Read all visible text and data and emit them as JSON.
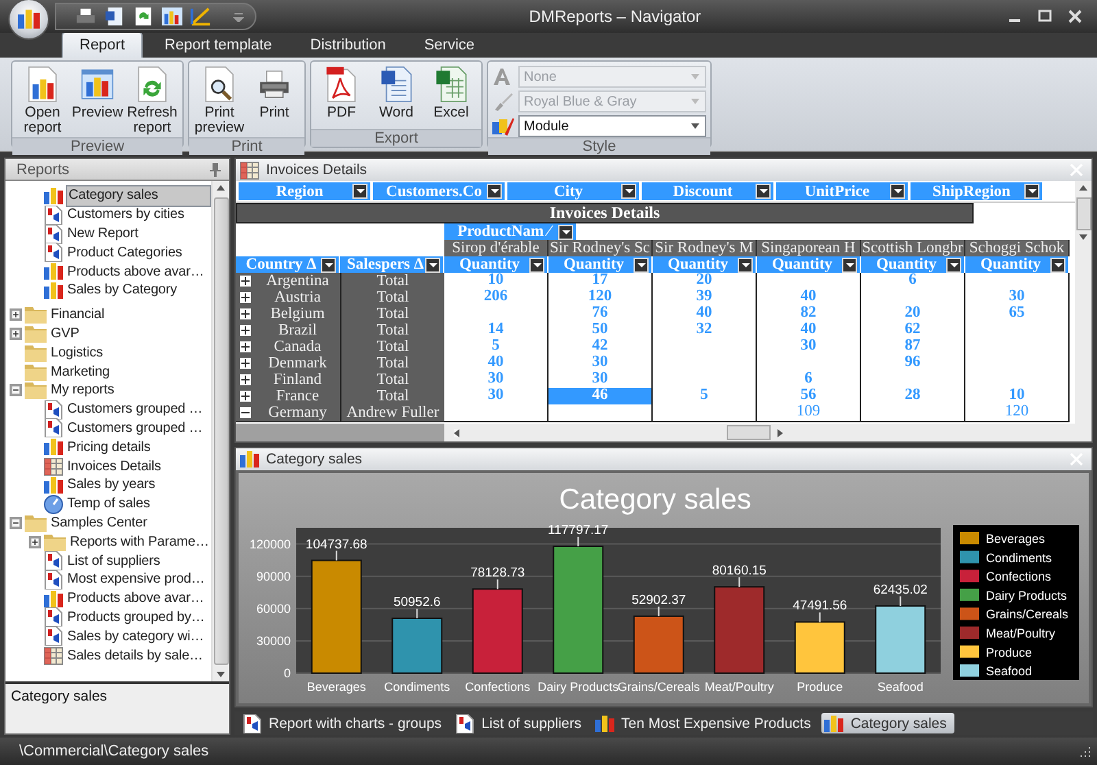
{
  "window": {
    "title": "DMReports – Navigator"
  },
  "ribbon_tabs": [
    {
      "label": "Report",
      "selected": true
    },
    {
      "label": "Report template",
      "selected": false
    },
    {
      "label": "Distribution",
      "selected": false
    },
    {
      "label": "Service",
      "selected": false
    }
  ],
  "ribbon_groups": [
    {
      "title": "Preview",
      "kind": "buttons",
      "buttons": [
        {
          "label": "Open report",
          "kind": "open"
        },
        {
          "label": "Preview",
          "kind": "preview"
        },
        {
          "label": "Refresh report",
          "kind": "refresh"
        }
      ]
    },
    {
      "title": "Print",
      "kind": "buttons",
      "buttons": [
        {
          "label": "Print preview",
          "kind": "print-preview"
        },
        {
          "label": "Print",
          "kind": "print"
        }
      ]
    },
    {
      "title": "Export",
      "kind": "buttons",
      "buttons": [
        {
          "label": "PDF",
          "kind": "pdf"
        },
        {
          "label": "Word",
          "kind": "word"
        },
        {
          "label": "Excel",
          "kind": "excel"
        }
      ]
    },
    {
      "title": "Style",
      "kind": "selects",
      "selects": [
        {
          "value": "None",
          "kind": "font",
          "disabled": true
        },
        {
          "value": "Royal Blue & Gray",
          "kind": "brush",
          "disabled": true
        },
        {
          "value": "Module",
          "kind": "palette",
          "disabled": false
        }
      ]
    }
  ],
  "left_panel": {
    "title": "Reports",
    "tree": {
      "continued": [
        {
          "label": "Category sales",
          "kind": "chart",
          "selected": true
        },
        {
          "label": "Customers by cities",
          "kind": "doc",
          "selected": false
        },
        {
          "label": "New Report",
          "kind": "doc",
          "selected": false
        },
        {
          "label": "Product Categories",
          "kind": "doc",
          "selected": false
        },
        {
          "label": "Products above avar…",
          "kind": "chart",
          "selected": false
        },
        {
          "label": "Sales by Category",
          "kind": "chart",
          "selected": false
        }
      ],
      "folders": [
        {
          "label": "Financial",
          "kind": "folder",
          "expanded": false,
          "selected": false
        },
        {
          "label": "GVP",
          "kind": "folder",
          "expanded": false,
          "selected": false
        },
        {
          "label": "Logistics",
          "kind": "folder",
          "selected": false
        },
        {
          "label": "Marketing",
          "kind": "folder",
          "selected": false
        },
        {
          "label": "My reports",
          "kind": "folder",
          "expanded": true,
          "selected": false,
          "children": [
            {
              "label": "Customers grouped …",
              "kind": "doc",
              "selected": false
            },
            {
              "label": "Customers grouped …",
              "kind": "doc",
              "selected": false
            },
            {
              "label": "Pricing details",
              "kind": "chart",
              "selected": false
            },
            {
              "label": "Invoices Details",
              "kind": "table",
              "selected": false
            },
            {
              "label": "Sales by years",
              "kind": "chart",
              "selected": false
            },
            {
              "label": "Temp of sales",
              "kind": "gauge",
              "selected": false
            }
          ]
        },
        {
          "label": "Samples Center",
          "kind": "folder",
          "expanded": true,
          "selected": false,
          "children": [
            {
              "label": "Reports with Parame…",
              "kind": "folder",
              "expanded": false,
              "selected": false
            },
            {
              "label": "List of suppliers",
              "kind": "doc",
              "selected": false
            },
            {
              "label": "Most expensive prod…",
              "kind": "doc",
              "selected": false
            },
            {
              "label": "Products above avar…",
              "kind": "chart",
              "selected": false
            },
            {
              "label": "Products grouped by…",
              "kind": "doc",
              "selected": false
            },
            {
              "label": "Sales by category wi…",
              "kind": "doc",
              "selected": false
            },
            {
              "label": "Sales details by sale…",
              "kind": "table",
              "selected": false
            }
          ]
        }
      ]
    },
    "description": "Category sales"
  },
  "invoices_pane": {
    "title": "Invoices Details",
    "filter_fields": [
      "Region",
      "Customers.Co",
      "City",
      "Discount",
      "UnitPrice",
      "ShipRegion"
    ],
    "pivot_title": "Invoices Details",
    "column_field": {
      "label": "ProductNam",
      "sort": "⁄"
    },
    "row_fields": [
      {
        "label": "Country",
        "sort": "∆"
      },
      {
        "label": "Salespers",
        "sort": "∆"
      }
    ],
    "products": [
      "Sirop d'érable",
      "Sir Rodney's Sc",
      "Sir Rodney's M",
      "Singaporean H",
      "Scottish Longbr",
      "Schoggi Schok"
    ],
    "measures": [
      "Quantity",
      "Quantity",
      "Quantity",
      "Quantity",
      "Quantity",
      "Quantity"
    ],
    "rows": [
      {
        "country": "Argentina",
        "salesperson": "Total",
        "expanded": false,
        "cells": [
          {
            "value": "10",
            "selected": false
          },
          {
            "value": "17",
            "selected": false
          },
          {
            "value": "20",
            "selected": false
          },
          {
            "selected": false
          },
          {
            "value": "6",
            "selected": false
          },
          {
            "selected": false
          }
        ]
      },
      {
        "country": "Austria",
        "salesperson": "Total",
        "expanded": false,
        "cells": [
          {
            "value": "206",
            "selected": false
          },
          {
            "value": "120",
            "selected": false
          },
          {
            "value": "39",
            "selected": false
          },
          {
            "value": "40",
            "selected": false
          },
          {
            "selected": false
          },
          {
            "value": "30",
            "selected": false
          }
        ]
      },
      {
        "country": "Belgium",
        "salesperson": "Total",
        "expanded": false,
        "cells": [
          {
            "selected": false
          },
          {
            "value": "76",
            "selected": false
          },
          {
            "value": "40",
            "selected": false
          },
          {
            "value": "82",
            "selected": false
          },
          {
            "value": "20",
            "selected": false
          },
          {
            "value": "65",
            "selected": false
          }
        ]
      },
      {
        "country": "Brazil",
        "salesperson": "Total",
        "expanded": false,
        "cells": [
          {
            "value": "14",
            "selected": false
          },
          {
            "value": "50",
            "selected": false
          },
          {
            "value": "32",
            "selected": false
          },
          {
            "value": "40",
            "selected": false
          },
          {
            "value": "62",
            "selected": false
          },
          {
            "selected": false
          }
        ]
      },
      {
        "country": "Canada",
        "salesperson": "Total",
        "expanded": false,
        "cells": [
          {
            "value": "5",
            "selected": false
          },
          {
            "value": "42",
            "selected": false
          },
          {
            "selected": false
          },
          {
            "value": "30",
            "selected": false
          },
          {
            "value": "87",
            "selected": false
          },
          {
            "selected": false
          }
        ]
      },
      {
        "country": "Denmark",
        "salesperson": "Total",
        "expanded": false,
        "cells": [
          {
            "value": "40",
            "selected": false
          },
          {
            "value": "30",
            "selected": false
          },
          {
            "selected": false
          },
          {
            "selected": false
          },
          {
            "value": "96",
            "selected": false
          },
          {
            "selected": false
          }
        ]
      },
      {
        "country": "Finland",
        "salesperson": "Total",
        "expanded": false,
        "cells": [
          {
            "value": "30",
            "selected": false
          },
          {
            "value": "30",
            "selected": false
          },
          {
            "selected": false
          },
          {
            "value": "6",
            "selected": false
          },
          {
            "selected": false
          },
          {
            "selected": false
          }
        ]
      },
      {
        "country": "France",
        "salesperson": "Total",
        "expanded": false,
        "cells": [
          {
            "value": "30",
            "selected": false
          },
          {
            "value": "46",
            "selected": true
          },
          {
            "value": "5",
            "selected": false
          },
          {
            "value": "56",
            "selected": false
          },
          {
            "value": "28",
            "selected": false
          },
          {
            "value": "10",
            "selected": false
          }
        ]
      },
      {
        "country": "Germany",
        "salesperson": "Andrew Fuller",
        "expanded": true,
        "cells": [
          {
            "selected": false
          },
          {
            "selected": false
          },
          {
            "selected": false
          },
          {
            "value": "109",
            "selected": false
          },
          {
            "selected": false
          },
          {
            "value": "120",
            "selected": false
          }
        ]
      }
    ]
  },
  "chart_pane": {
    "title": "Category sales",
    "chart_data": {
      "type": "bar",
      "title": "Category sales",
      "categories": [
        "Beverages",
        "Condiments",
        "Confections",
        "Dairy Products",
        "Grains/Cereals",
        "Meat/Poultry",
        "Produce",
        "Seafood"
      ],
      "values": [
        104737.68,
        50952.6,
        78128.73,
        117797.17,
        52902.37,
        80160.15,
        47491.56,
        62435.02
      ],
      "ylim": [
        0,
        135000
      ],
      "yticks": [
        0,
        30000,
        60000,
        90000,
        120000
      ],
      "grid": true,
      "data_labels": true
    },
    "legend": [
      {
        "label": "Beverages",
        "color": "#c98a00"
      },
      {
        "label": "Condiments",
        "color": "#2f93ad"
      },
      {
        "label": "Confections",
        "color": "#c8213a"
      },
      {
        "label": "Dairy Products",
        "color": "#45a047"
      },
      {
        "label": "Grains/Cereals",
        "color": "#cc5418"
      },
      {
        "label": "Meat/Poultry",
        "color": "#9e2a2b"
      },
      {
        "label": "Produce",
        "color": "#ffc53d"
      },
      {
        "label": "Seafood",
        "color": "#8fd0de"
      }
    ]
  },
  "bottom_tabs": [
    {
      "label": "Report with charts - groups",
      "kind": "doc",
      "selected": false
    },
    {
      "label": "List of suppliers",
      "kind": "doc",
      "selected": false
    },
    {
      "label": "Ten Most Expensive Products",
      "kind": "chart",
      "selected": false
    },
    {
      "label": "Category sales",
      "kind": "chart",
      "selected": true
    }
  ],
  "status_bar": {
    "path": "\\Commercial\\Category sales"
  }
}
